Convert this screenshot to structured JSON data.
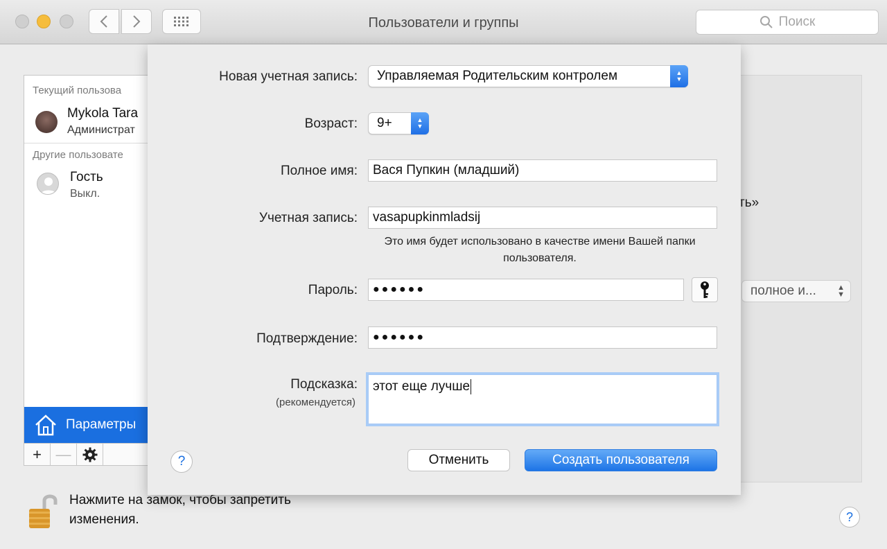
{
  "window": {
    "title": "Пользователи и группы",
    "search_placeholder": "Поиск"
  },
  "sidebar": {
    "current_section": "Текущий пользова",
    "current_user": {
      "name": "Mykola Tara",
      "role": "Администрат"
    },
    "other_section": "Другие пользовате",
    "guest": {
      "name": "Гость",
      "status": "Выкл."
    },
    "params_label": "Параметры",
    "add_label": "+",
    "remove_label": "—"
  },
  "background": {
    "right_fragment": "ть»",
    "display_select": "полное и...",
    "lock_text": "Нажмите на замок, чтобы запретить изменения.",
    "help_label": "?"
  },
  "sheet": {
    "new_account_label": "Новая учетная запись:",
    "new_account_value": "Управляемая Родительским контролем",
    "age_label": "Возраст:",
    "age_value": "9+",
    "fullname_label": "Полное имя:",
    "fullname_value": "Вася Пупкин (младший)",
    "account_label": "Учетная запись:",
    "account_value": "vasapupkinmladsij",
    "account_note": "Это имя будет использовано в качестве имени Вашей папки пользователя.",
    "password_label": "Пароль:",
    "password_value": "●●●●●●",
    "confirm_label": "Подтверждение:",
    "confirm_value": "●●●●●●",
    "hint_label": "Подсказка:",
    "hint_sub_label": "(рекомендуется)",
    "hint_value": "этот еще лучше",
    "help_label": "?",
    "cancel_label": "Отменить",
    "create_label": "Создать пользователя"
  },
  "colors": {
    "accent": "#1a6fe0",
    "primary_button": "#1d74e6",
    "focus_ring": "#a9ccf7"
  }
}
